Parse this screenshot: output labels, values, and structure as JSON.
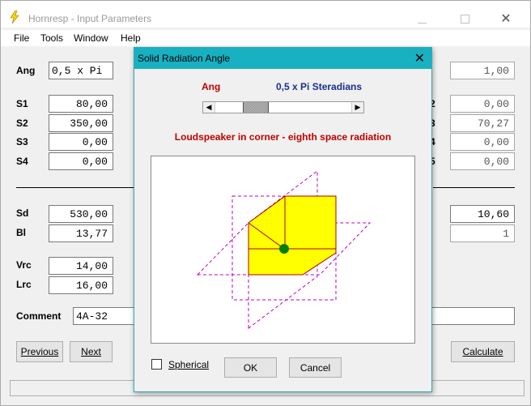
{
  "window": {
    "title": "Hornresp - Input Parameters",
    "menu": [
      "File",
      "Tools",
      "Window",
      "Help"
    ]
  },
  "params": {
    "ang": {
      "label": "Ang",
      "value": "0,5 x Pi"
    },
    "s1": {
      "label": "S1",
      "value": "80,00"
    },
    "s2": {
      "label": "S2",
      "value": "350,00"
    },
    "s3": {
      "label": "S3",
      "value": "0,00"
    },
    "s4": {
      "label": "S4",
      "value": "0,00"
    },
    "sd": {
      "label": "Sd",
      "value": "530,00"
    },
    "bl": {
      "label": "Bl",
      "value": "13,77"
    },
    "vrc": {
      "label": "Vrc",
      "value": "14,00"
    },
    "lrc": {
      "label": "Lrc",
      "value": "16,00"
    },
    "comment": {
      "label": "Comment",
      "value": "4A-32"
    }
  },
  "right_fields": [
    "1,00",
    "0,00",
    "70,27",
    "0,00",
    "0,00",
    "10,60",
    "1"
  ],
  "right_label_fragments": [
    "2",
    "3",
    "4",
    "5"
  ],
  "buttons": {
    "previous": "Previous",
    "next": "Next",
    "calculate": "Calculate"
  },
  "dialog": {
    "title": "Solid Radiation Angle",
    "close": "✕",
    "ang_label": "Ang",
    "steradians": "0,5 x Pi Steradians",
    "description": "Loudspeaker in corner - eighth space radiation",
    "spherical_label": "Spherical",
    "spherical_checked": false,
    "ok": "OK",
    "cancel": "Cancel",
    "slider_fraction": 0.25
  },
  "colors": {
    "dialog_titlebar": "#17b1c1",
    "solid_fill": "#ffff00",
    "solid_edge": "#b00000",
    "dashed_planes": "#c000c0",
    "center_dot": "#008000",
    "red_text": "#c00000",
    "blue_text": "#1a2e8c"
  }
}
